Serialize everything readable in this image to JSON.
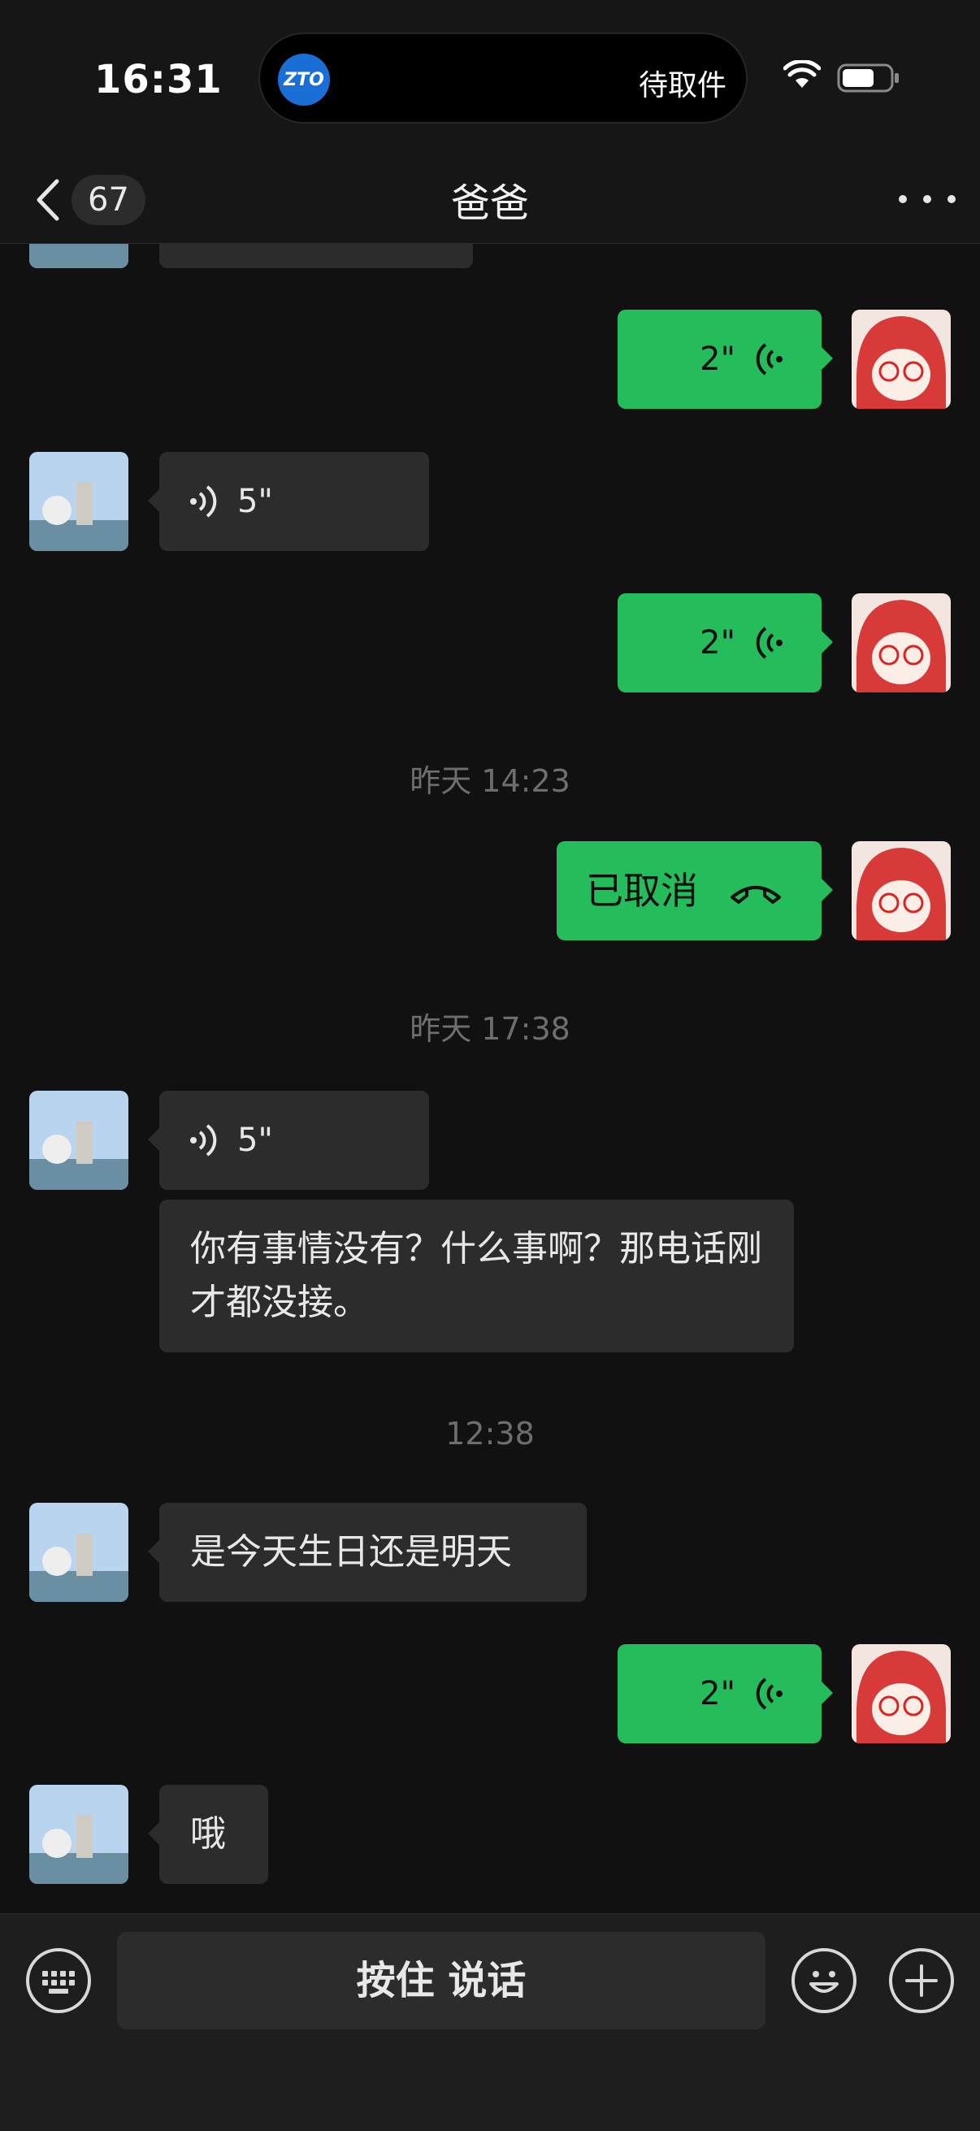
{
  "status_bar": {
    "time": "16:31",
    "island_logo": "ZTO",
    "island_text": "待取件"
  },
  "nav": {
    "back_count": "67",
    "title": "爸爸"
  },
  "messages": {
    "m1_secs": "2\"",
    "m2_secs": "5\"",
    "m3_secs": "2\"",
    "ts1": "昨天 14:23",
    "m4_text": "已取消",
    "ts2": "昨天 17:38",
    "m5_secs": "5\"",
    "m6_text": "你有事情没有？什么事啊？那电话刚才都没接。",
    "ts3": "12:38",
    "m7_text": "是今天生日还是明天",
    "m8_secs": "2\"",
    "m9_text": "哦"
  },
  "input": {
    "hold_label": "按住 说话"
  },
  "colors": {
    "accent_green": "#25bd5c",
    "bubble_in": "#2c2c2c",
    "background": "#111111"
  },
  "icons": [
    "chevron-left-icon",
    "more-icon",
    "voice-wave-icon",
    "phone-hangup-icon",
    "keyboard-icon",
    "emoji-icon",
    "plus-icon",
    "wifi-icon",
    "battery-icon"
  ]
}
